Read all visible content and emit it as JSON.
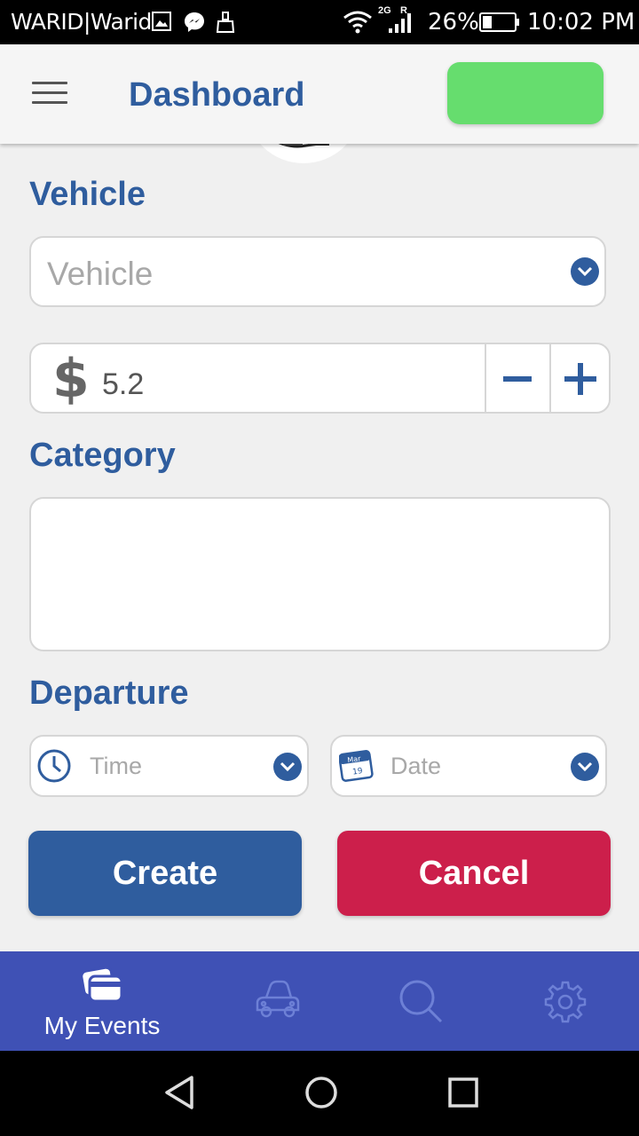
{
  "status_bar": {
    "carrier": "WARID|Warid",
    "network": "2G",
    "roaming": "R",
    "battery": "26%",
    "time": "10:02 PM"
  },
  "header": {
    "title": "Dashboard",
    "menu_icon": "hamburger-menu-icon",
    "action_color": "#66dd6e"
  },
  "form": {
    "vehicle": {
      "label": "Vehicle",
      "placeholder": "Vehicle"
    },
    "price": {
      "currency_symbol": "$",
      "value": "5.2",
      "decrement_icon": "minus-icon",
      "increment_icon": "plus-icon"
    },
    "category": {
      "label": "Category",
      "value": ""
    },
    "departure": {
      "label": "Departure",
      "time_placeholder": "Time",
      "date_placeholder": "Date",
      "calendar_month": "Mar",
      "calendar_day": "19"
    },
    "create_label": "Create",
    "cancel_label": "Cancel"
  },
  "colors": {
    "primary": "#2f5d9e",
    "danger": "#cc1f4b",
    "tab_bar": "#3f51b5"
  },
  "tabs": [
    {
      "label": "My Events",
      "icon": "cards-icon",
      "active": true
    },
    {
      "label": "",
      "icon": "car-icon",
      "active": false
    },
    {
      "label": "",
      "icon": "search-icon",
      "active": false
    },
    {
      "label": "",
      "icon": "gear-icon",
      "active": false
    }
  ],
  "nav": [
    "back-icon",
    "home-icon",
    "recents-icon"
  ]
}
